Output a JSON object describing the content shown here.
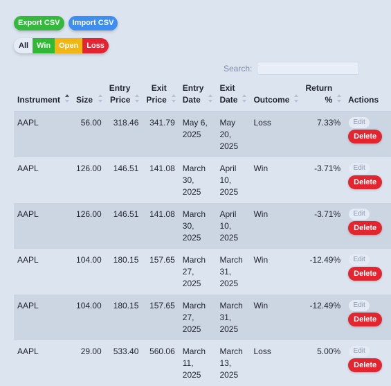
{
  "toolbar": {
    "export_label": "Export CSV",
    "import_label": "Import CSV"
  },
  "filters": {
    "all": "All",
    "win": "Win",
    "open": "Open",
    "loss": "Loss"
  },
  "search": {
    "label": "Search:",
    "value": "",
    "placeholder": ""
  },
  "colors": {
    "export": "#34b93c",
    "import": "#3e8ef0",
    "win": "#31b936",
    "open": "#f2b511",
    "loss": "#e42431",
    "delete": "#e32530"
  },
  "table": {
    "headers": {
      "instrument": "Instrument",
      "size": "Size",
      "entry_price": "Entry Price",
      "exit_price": "Exit Price",
      "entry_date": "Entry Date",
      "exit_date": "Exit Date",
      "outcome": "Outcome",
      "return_pct": "Return %",
      "actions": "Actions"
    },
    "edit_label": "Edit",
    "delete_label": "Delete",
    "rows": [
      {
        "instrument": "AAPL",
        "size": "56.00",
        "entry_price": "318.46",
        "exit_price": "341.79",
        "entry_date": "May 6, 2025",
        "exit_date": "May 20, 2025",
        "outcome": "Loss",
        "return_pct": "7.33%"
      },
      {
        "instrument": "AAPL",
        "size": "126.00",
        "entry_price": "146.51",
        "exit_price": "141.08",
        "entry_date": "March 30, 2025",
        "exit_date": "April 10, 2025",
        "outcome": "Win",
        "return_pct": "-3.71%"
      },
      {
        "instrument": "AAPL",
        "size": "126.00",
        "entry_price": "146.51",
        "exit_price": "141.08",
        "entry_date": "March 30, 2025",
        "exit_date": "April 10, 2025",
        "outcome": "Win",
        "return_pct": "-3.71%"
      },
      {
        "instrument": "AAPL",
        "size": "104.00",
        "entry_price": "180.15",
        "exit_price": "157.65",
        "entry_date": "March 27, 2025",
        "exit_date": "March 31, 2025",
        "outcome": "Win",
        "return_pct": "-12.49%"
      },
      {
        "instrument": "AAPL",
        "size": "104.00",
        "entry_price": "180.15",
        "exit_price": "157.65",
        "entry_date": "March 27, 2025",
        "exit_date": "March 31, 2025",
        "outcome": "Win",
        "return_pct": "-12.49%"
      },
      {
        "instrument": "AAPL",
        "size": "29.00",
        "entry_price": "533.40",
        "exit_price": "560.06",
        "entry_date": "March 11, 2025",
        "exit_date": "March 13, 2025",
        "outcome": "Loss",
        "return_pct": "5.00%"
      }
    ]
  }
}
